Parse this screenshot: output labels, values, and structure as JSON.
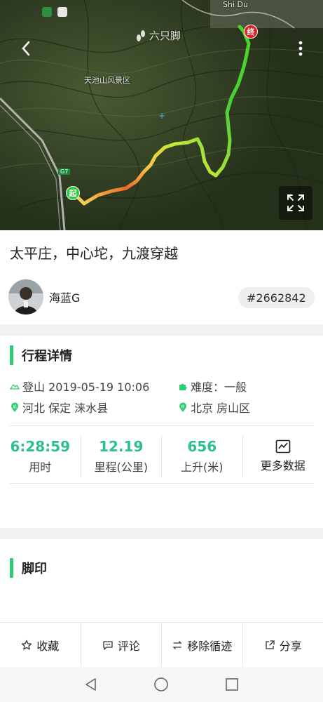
{
  "map": {
    "brand": "六只脚",
    "scenic_label": "天池山风景区",
    "town_label": "Shi Du",
    "road_tag": "G7",
    "start_pin": "起",
    "end_pin": "终",
    "icons": {
      "back": "chevron-left-icon",
      "more": "more-vertical-icon",
      "fullscreen": "fullscreen-icon"
    }
  },
  "trail": {
    "title": "太平庄，中心坨，九渡穿越",
    "author": "海蓝G",
    "id": "#2662842"
  },
  "details": {
    "heading": "行程详情",
    "activity": "登山 2019-05-19 10:06",
    "difficulty": "难度：一般",
    "start_location": "河北 保定 涞水县",
    "end_location": "北京 房山区",
    "start_marker": "起",
    "end_marker": "终"
  },
  "stats": [
    {
      "value": "6:28:59",
      "label": "用时"
    },
    {
      "value": "12.19",
      "label": "里程(公里)"
    },
    {
      "value": "656",
      "label": "上升(米)"
    }
  ],
  "more_data_label": "更多数据",
  "footprint": {
    "heading": "脚印"
  },
  "actions": [
    {
      "label": "收藏",
      "icon": "star-icon"
    },
    {
      "label": "评论",
      "icon": "comment-icon"
    },
    {
      "label": "移除循迹",
      "icon": "route-icon"
    },
    {
      "label": "分享",
      "icon": "share-icon"
    }
  ],
  "colors": {
    "accent": "#2dcc70",
    "stat": "#2dc08e",
    "end_pin": "#e02020"
  }
}
